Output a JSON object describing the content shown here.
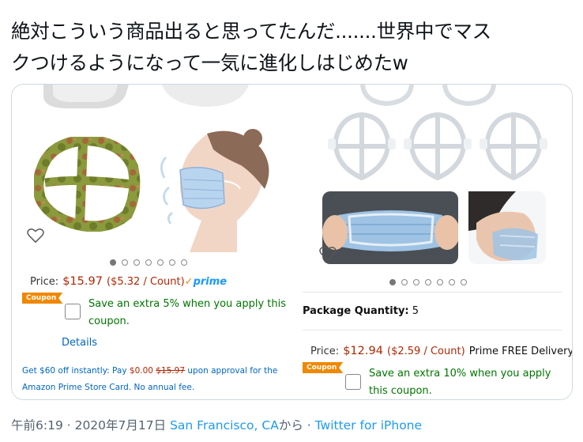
{
  "tweet": {
    "text_line1": "絶対こういう商品出ると思ってたんだ.......世界中でマス",
    "text_line2": "クつけるようになって一気に進化しはじめたw"
  },
  "left_product": {
    "price_label": "Price:",
    "price": "$15.97",
    "unit_price": "($5.32 / Count)",
    "prime_check": "✓",
    "prime": "prime",
    "coupon_badge": "Coupon",
    "coupon_line1": "Save an extra 5% when you apply this",
    "coupon_line2": "coupon.",
    "details": "Details",
    "offer_line1_a": "Get $60 off instantly: Pay ",
    "offer_line1_b": "$0.00",
    "offer_line1_c": "$15.97",
    "offer_line1_d": " upon approval for the",
    "offer_line2": "Amazon Prime Store Card. No annual fee.",
    "carousel_dots": 7,
    "carousel_active": 0
  },
  "right_product": {
    "package_label": "Package Quantity:",
    "package_value": "5",
    "price_label": "Price:",
    "price": "$12.94",
    "unit_price": "($2.59 / Count)",
    "delivery": "Prime FREE Delivery",
    "coupon_badge": "Coupon",
    "coupon_line1": "Save an extra 10% when you apply",
    "coupon_line2": "this coupon.",
    "carousel_dots": 7,
    "carousel_active": 0
  },
  "footer": {
    "time_date": "午前6:19 · 2020年7月17日",
    "location": "San Francisco, CA",
    "from": "から · ",
    "client": "Twitter for iPhone"
  },
  "colors": {
    "price_red": "#b12704",
    "coupon_orange": "#f08804",
    "coupon_green": "#007600",
    "link_blue": "#0066c0",
    "twitter_blue": "#1d9bf0"
  }
}
